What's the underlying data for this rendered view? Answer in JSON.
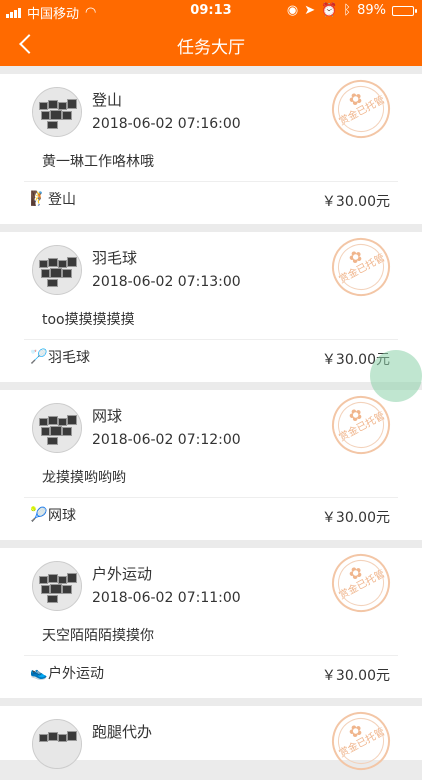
{
  "status_bar": {
    "carrier": "中国移动",
    "time": "09:13",
    "battery": "89%"
  },
  "nav": {
    "title": "任务大厅"
  },
  "tasks": [
    {
      "title": "登山",
      "time": "2018-06-02 07:16:00",
      "content": "黄一琳工作咯林哦",
      "category": "登山",
      "category_icon": "hiking-icon",
      "price": "￥30.00元",
      "stamp": "赏金已托管"
    },
    {
      "title": "羽毛球",
      "time": "2018-06-02 07:13:00",
      "content": "too摸摸摸摸摸",
      "category": "羽毛球",
      "category_icon": "badminton-icon",
      "price": "￥30.00元",
      "stamp": "赏金已托管"
    },
    {
      "title": "网球",
      "time": "2018-06-02 07:12:00",
      "content": "龙摸摸哟哟哟",
      "category": "网球",
      "category_icon": "tennis-icon",
      "price": "￥30.00元",
      "stamp": "赏金已托管"
    },
    {
      "title": "户外运动",
      "time": "2018-06-02 07:11:00",
      "content": "天空陌陌陌摸摸你",
      "category": "户外运动",
      "category_icon": "outdoor-shoe-icon",
      "price": "￥30.00元",
      "stamp": "赏金已托管"
    },
    {
      "title": "跑腿代办",
      "stamp": "赏金已托管"
    }
  ],
  "colors": {
    "header": "#ff6a00",
    "background": "#ebebeb",
    "stamp": "#f0b58c"
  }
}
